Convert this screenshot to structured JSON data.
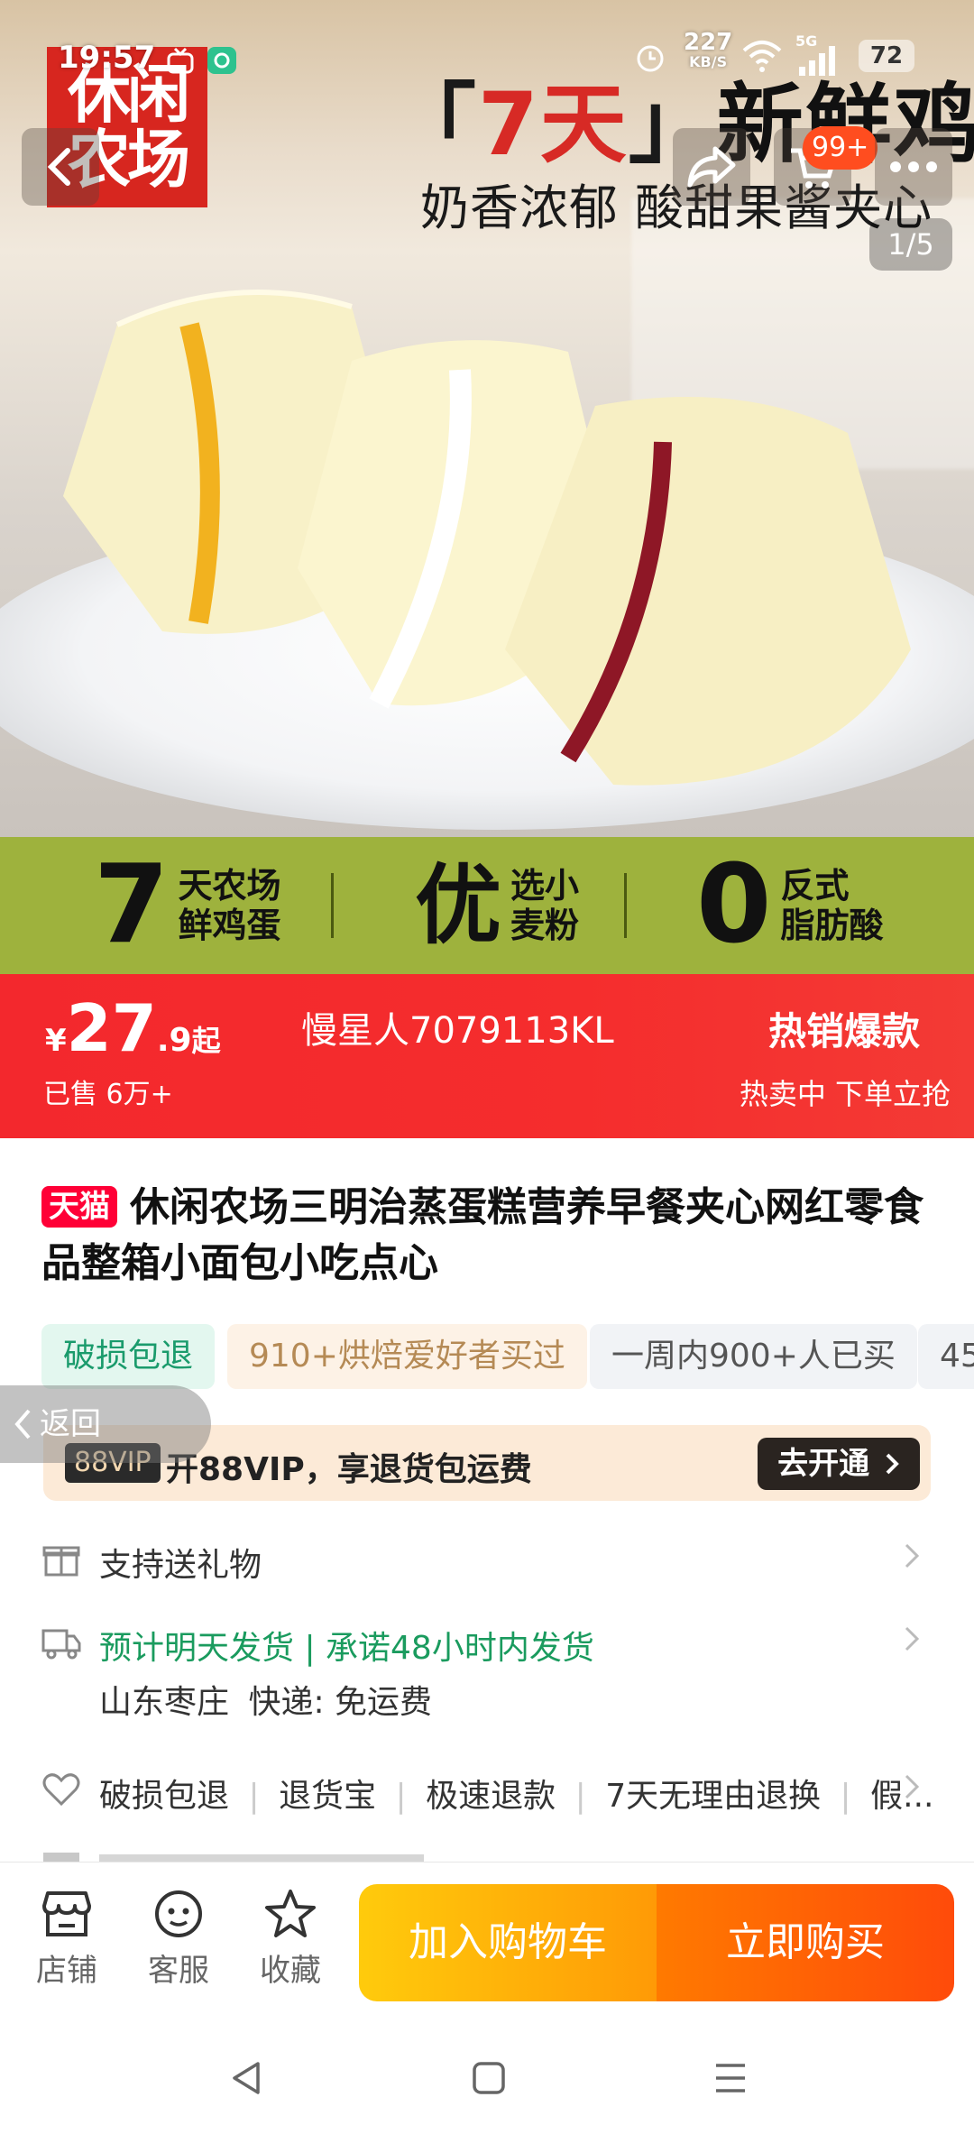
{
  "status_bar": {
    "time": "19:57",
    "net_speed": "227",
    "net_unit": "KB/S",
    "signal": "5G",
    "battery": "72"
  },
  "hero": {
    "brand_logo_line1": "休闲",
    "brand_logo_line2": "农场",
    "title_open": "「",
    "title_highlight": "7天",
    "title_close": "」",
    "title_rest": "新鲜鸡蛋",
    "subtitle": "奶香浓郁 酸甜果酱夹心",
    "cart_badge": "99+",
    "page_indicator": "1/5"
  },
  "features": [
    {
      "big": "7",
      "line1": "天农场",
      "line2": "鲜鸡蛋"
    },
    {
      "big": "优",
      "line1": "选小",
      "line2": "麦粉"
    },
    {
      "big": "0",
      "line1": "反式",
      "line2": "脂肪酸"
    }
  ],
  "price_bar": {
    "currency": "¥",
    "price_int": "27",
    "price_dec": ".9",
    "price_suffix": "起",
    "seller": "慢星人7079113KL",
    "hot_label": "热销爆款",
    "sold": "已售 6万+",
    "hot_sub": "热卖中 下单立抢"
  },
  "product": {
    "platform_tag": "天猫",
    "title": "休闲农场三明治蒸蛋糕营养早餐夹心网红零食品整箱小面包小吃点心"
  },
  "tags": [
    {
      "text": "破损包退"
    },
    {
      "text": "910+烘焙爱好者买过"
    },
    {
      "text": "一周内900+人已买"
    },
    {
      "text": "45"
    }
  ],
  "back_float": {
    "label": "返回"
  },
  "vip": {
    "badge": "88VIP",
    "text": "开88VIP，享退货包运费",
    "cta": "去开通"
  },
  "gift": {
    "label": "支持送礼物"
  },
  "shipping": {
    "promise": "预计明天发货 | 承诺48小时内发货",
    "origin": "山东枣庄",
    "express": "快递: 免运费"
  },
  "guarantees": [
    "破损包退",
    "退货宝",
    "极速退款",
    "7天无理由退换",
    "假..."
  ],
  "bottom_bar": {
    "shop": "店铺",
    "service": "客服",
    "favorite": "收藏",
    "add_cart": "加入购物车",
    "buy_now": "立即购买"
  },
  "colors": {
    "price_red": "#f3282d",
    "feature_green": "#9eb23d",
    "tmall_red": "#ff0036",
    "promise_green": "#1a9b5e",
    "cart_yellow": "#ffcb0c",
    "buy_orange": "#ff4b0a"
  }
}
